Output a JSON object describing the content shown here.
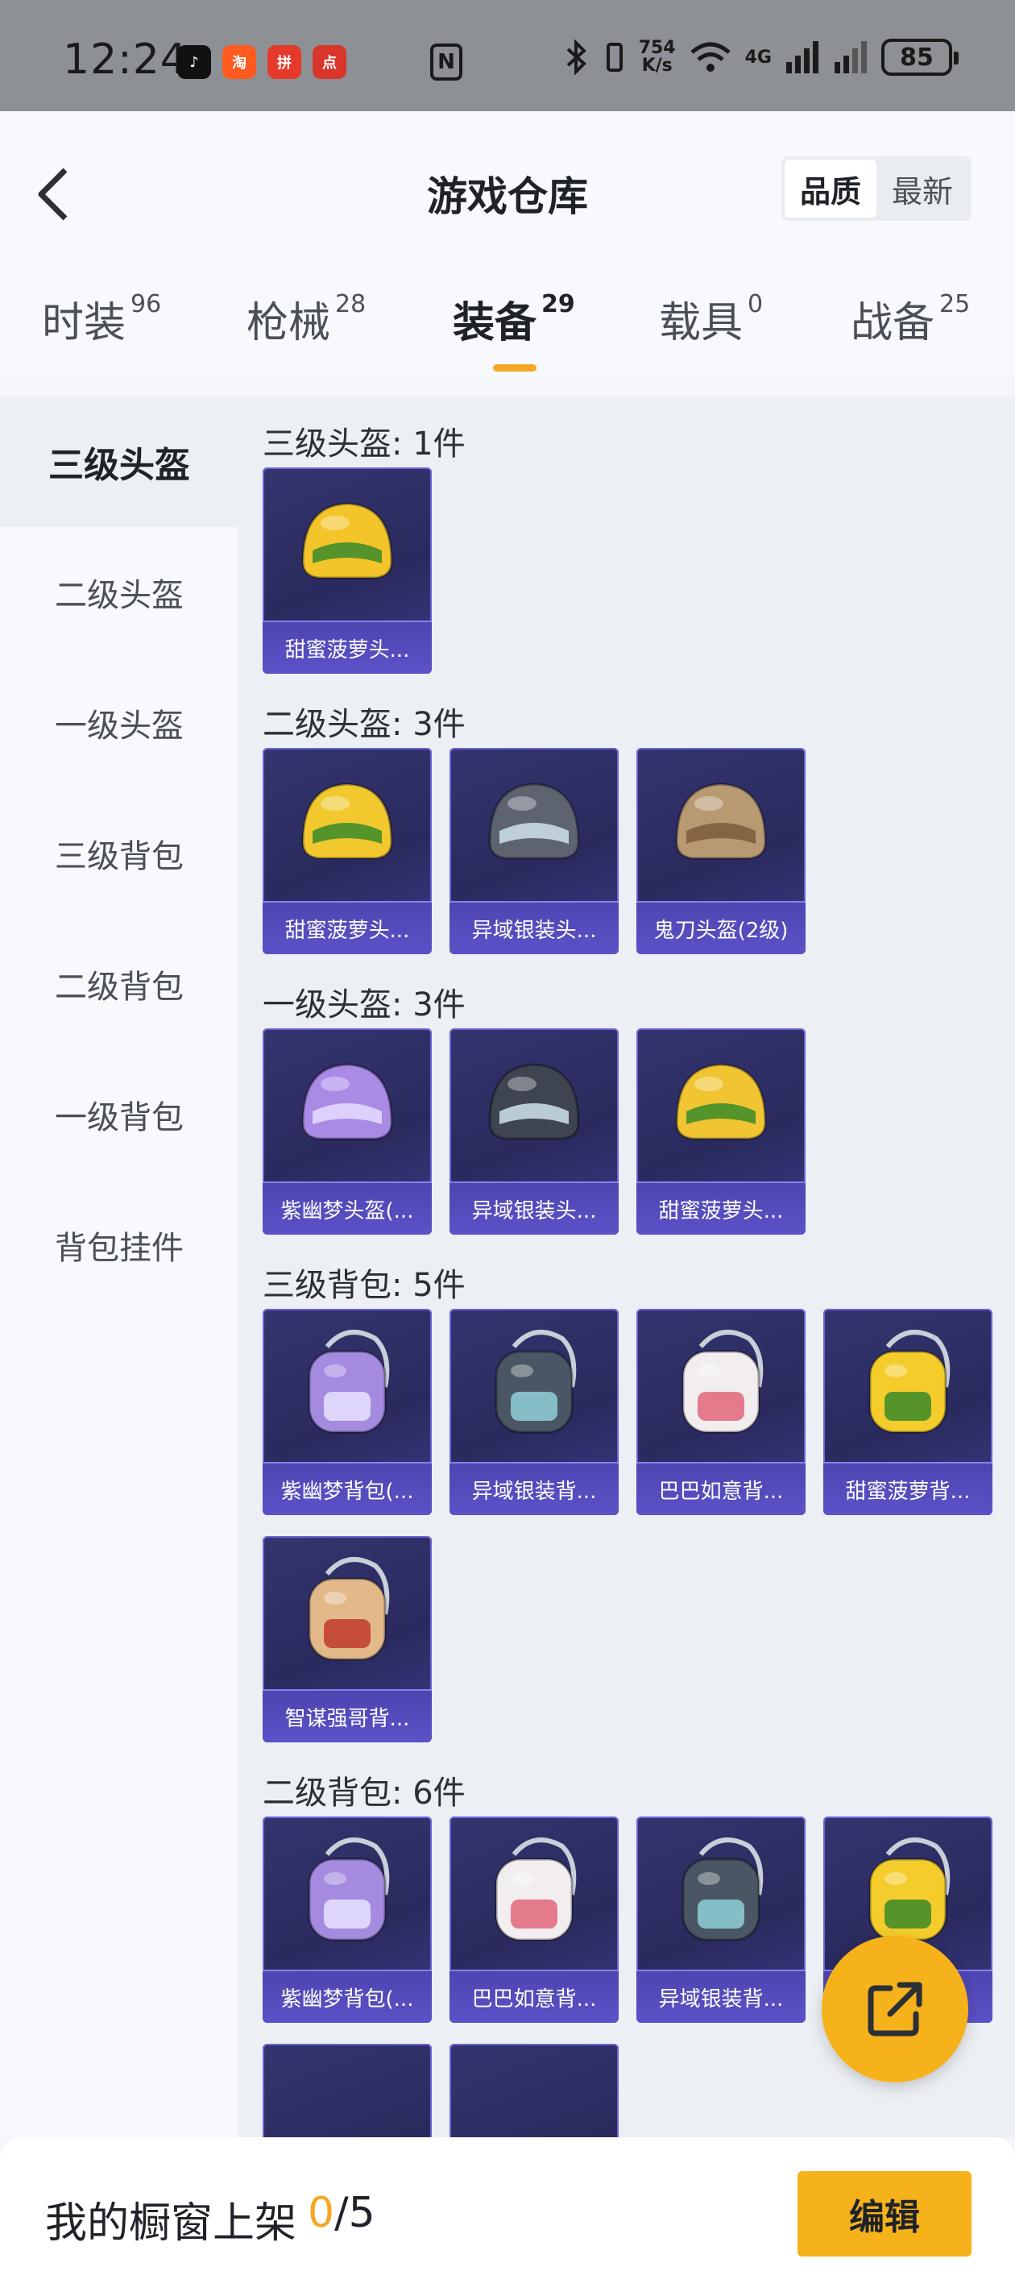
{
  "status_bar": {
    "time": "12:24",
    "apps": [
      {
        "name": "tiktok-icon",
        "color": "#111111",
        "glyph": "♪"
      },
      {
        "name": "taobao-icon",
        "color": "#ff5a1f",
        "glyph": "淘"
      },
      {
        "name": "pinduoduo-icon",
        "color": "#e6392b",
        "glyph": "拼"
      },
      {
        "name": "app-icon-red",
        "color": "#d9352b",
        "glyph": "点"
      }
    ],
    "nfc": "N",
    "net_speed_value": "754",
    "net_speed_unit": "K/s",
    "signal": "4G",
    "battery": "85"
  },
  "header": {
    "title": "游戏仓库",
    "sort_options": [
      "品质",
      "最新"
    ],
    "sort_active_index": 0
  },
  "tabs": [
    {
      "label": "时装",
      "count": "96"
    },
    {
      "label": "枪械",
      "count": "28"
    },
    {
      "label": "装备",
      "count": "29"
    },
    {
      "label": "载具",
      "count": "0"
    },
    {
      "label": "战备",
      "count": "25"
    }
  ],
  "active_tab_index": 2,
  "accent_color": "#f5a623",
  "sidebar": {
    "items": [
      "三级头盔",
      "二级头盔",
      "一级头盔",
      "三级背包",
      "二级背包",
      "一级背包",
      "背包挂件"
    ],
    "active_index": 0
  },
  "sections": [
    {
      "title": "三级头盔: 1件",
      "items": [
        {
          "name": "甜蜜菠萝头...",
          "kind": "helmet",
          "color": "#f3c52a",
          "accent": "#3a8a2a"
        }
      ]
    },
    {
      "title": "二级头盔: 3件",
      "items": [
        {
          "name": "甜蜜菠萝头...",
          "kind": "helmet",
          "color": "#f1c92f",
          "accent": "#3a8a2a"
        },
        {
          "name": "异域银装头...",
          "kind": "helmet",
          "color": "#5d6470",
          "accent": "#cfe3ea"
        },
        {
          "name": "鬼刀头盔(2级)",
          "kind": "helmet",
          "color": "#b89a72",
          "accent": "#7a5a3a"
        }
      ]
    },
    {
      "title": "一级头盔: 3件",
      "items": [
        {
          "name": "紫幽梦头盔(...",
          "kind": "helmet",
          "color": "#a98be6",
          "accent": "#e5dcff"
        },
        {
          "name": "异域银装头...",
          "kind": "helmet",
          "color": "#3e4450",
          "accent": "#cfe3ea"
        },
        {
          "name": "甜蜜菠萝头...",
          "kind": "helmet",
          "color": "#f0c531",
          "accent": "#3a8a2a"
        }
      ]
    },
    {
      "title": "三级背包: 5件",
      "items": [
        {
          "name": "紫幽梦背包(...",
          "kind": "backpack",
          "color": "#a58be0",
          "accent": "#e8e2ff"
        },
        {
          "name": "异域银装背...",
          "kind": "backpack",
          "color": "#4a5663",
          "accent": "#8fd0d8"
        },
        {
          "name": "巴巴如意背...",
          "kind": "backpack",
          "color": "#f2eef0",
          "accent": "#e2667a"
        },
        {
          "name": "甜蜜菠萝背...",
          "kind": "backpack",
          "color": "#f4cd2c",
          "accent": "#3a8a2a"
        },
        {
          "name": "智谋强哥背...",
          "kind": "backpack",
          "color": "#e4b98a",
          "accent": "#c0392b"
        }
      ]
    },
    {
      "title": "二级背包: 6件",
      "items": [
        {
          "name": "紫幽梦背包(...",
          "kind": "backpack",
          "color": "#a58be0",
          "accent": "#e8e2ff"
        },
        {
          "name": "巴巴如意背...",
          "kind": "backpack",
          "color": "#f2eef0",
          "accent": "#e2667a"
        },
        {
          "name": "异域银装背...",
          "kind": "backpack",
          "color": "#4a5663",
          "accent": "#8fd0d8"
        },
        {
          "name": "",
          "kind": "backpack",
          "color": "#f4cd2c",
          "accent": "#3a8a2a"
        },
        {
          "name": "",
          "kind": "empty",
          "color": "#2e2e66",
          "accent": "#2e2e66"
        },
        {
          "name": "",
          "kind": "empty",
          "color": "#2e2e66",
          "accent": "#2e2e66"
        }
      ]
    }
  ],
  "bottom_bar": {
    "shelf_label": "我的橱窗上架",
    "shelf_used": "0",
    "shelf_total": "/5",
    "edit_label": "编辑"
  }
}
